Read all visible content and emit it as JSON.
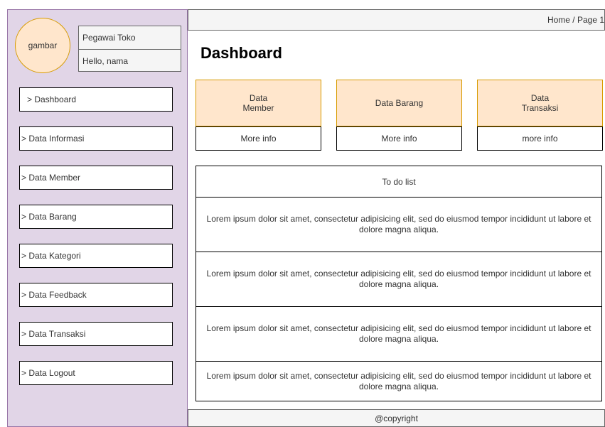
{
  "sidebar": {
    "avatar_text": "gambar",
    "user_role": "Pegawai Toko",
    "user_greeting": "Hello, nama",
    "items": [
      {
        "label": "> Dashboard"
      },
      {
        "label": "> Data Informasi"
      },
      {
        "label": "> Data Member"
      },
      {
        "label": "> Data Barang"
      },
      {
        "label": "> Data Kategori"
      },
      {
        "label": "> Data Feedback"
      },
      {
        "label": "> Data Transaksi"
      },
      {
        "label": "> Data Logout"
      }
    ]
  },
  "header": {
    "breadcrumb": "Home / Page 1"
  },
  "main": {
    "title": "Dashboard",
    "cards": [
      {
        "title": "Data Member",
        "link": "More info"
      },
      {
        "title": "Data Barang",
        "link": "More info"
      },
      {
        "title": "Data Transaksi",
        "link": "more info"
      }
    ],
    "todo": {
      "title": "To do list",
      "items": [
        "Lorem ipsum dolor sit amet, consectetur adipisicing elit, sed do eiusmod tempor incididunt ut labore et dolore magna aliqua.",
        "Lorem ipsum dolor sit amet, consectetur adipisicing elit, sed do eiusmod tempor incididunt ut labore et dolore magna aliqua.",
        "Lorem ipsum dolor sit amet, consectetur adipisicing elit, sed do eiusmod tempor incididunt ut labore et dolore magna aliqua.",
        "Lorem ipsum dolor sit amet, consectetur adipisicing elit, sed do eiusmod tempor incididunt ut labore et dolore magna aliqua."
      ]
    }
  },
  "footer": {
    "copyright": "@copyright"
  }
}
